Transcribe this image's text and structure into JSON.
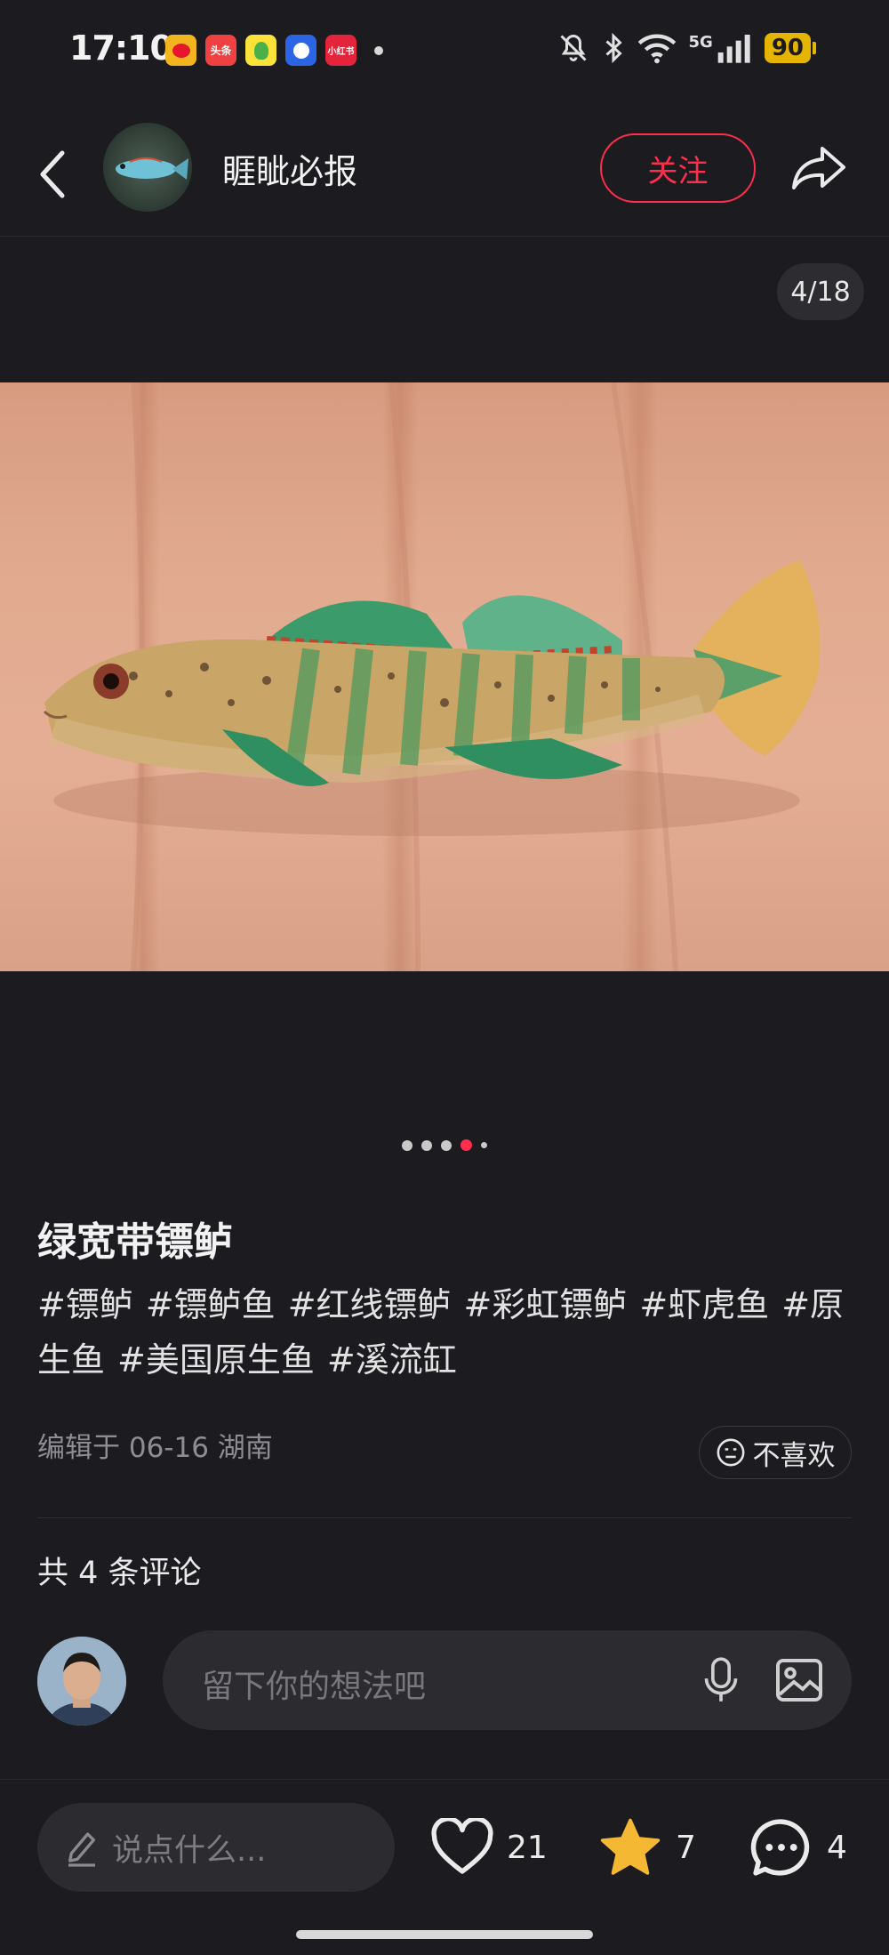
{
  "status_bar": {
    "time": "17:10",
    "apps": [
      "weibo-icon",
      "toutiao-icon",
      "qq-music-icon",
      "baidu-icon",
      "xiaohongshu-icon"
    ],
    "toutiao_text": "头条",
    "xhs_text": "小红书",
    "network": "5G",
    "battery": "90"
  },
  "header": {
    "author_name": "睚眦必报",
    "follow_label": "关注"
  },
  "gallery": {
    "counter": "4/18",
    "current_index": 4,
    "total": 18
  },
  "post": {
    "title": "绿宽带镖鲈",
    "tags": [
      "#镖鲈",
      "#镖鲈鱼",
      "#红线镖鲈",
      "#彩虹镖鲈",
      "#虾虎鱼",
      "#原生鱼",
      "#美国原生鱼",
      "#溪流缸"
    ],
    "edit_meta": "编辑于 06-16 湖南",
    "dislike_label": "不喜欢"
  },
  "comments": {
    "count_label": "共 4 条评论",
    "input_placeholder": "留下你的想法吧"
  },
  "bottom_bar": {
    "say_placeholder": "说点什么...",
    "likes": "21",
    "stars": "7",
    "comments": "4"
  },
  "colors": {
    "accent": "#ff2e4d",
    "star": "#f5b833",
    "background": "#1b1b20"
  }
}
